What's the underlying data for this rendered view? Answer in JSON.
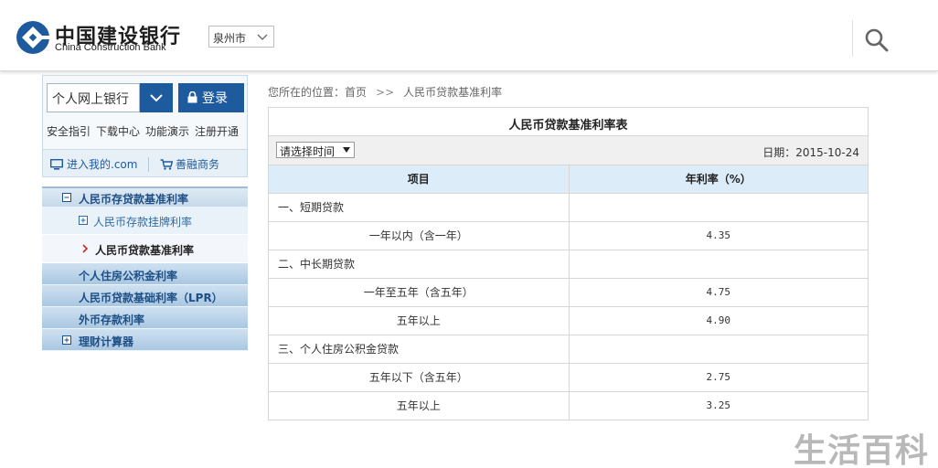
{
  "header": {
    "logo_cn": "中国建设银行",
    "logo_en": "China Construction Bank",
    "city": "泉州市"
  },
  "sidebar": {
    "bank_select": "个人网上银行",
    "login_label": "登录",
    "quick_links": [
      "安全指引",
      "下载中心",
      "功能演示",
      "注册开通"
    ],
    "enter_my": "进入我的.com",
    "shop": "善融商务",
    "menu": [
      {
        "label": "人民币存贷款基准利率",
        "kind": "top",
        "icon": "minus-box-icon"
      },
      {
        "label": "人民币存款挂牌利率",
        "kind": "sub",
        "icon": "plus-box-icon"
      },
      {
        "label": "人民币贷款基准利率",
        "kind": "sub-active",
        "icon": "chevron-right-icon"
      },
      {
        "label": "个人住房公积金利率",
        "kind": "main"
      },
      {
        "label": "人民币贷款基础利率（LPR）",
        "kind": "main"
      },
      {
        "label": "外币存款利率",
        "kind": "main"
      },
      {
        "label": "理财计算器",
        "kind": "main",
        "icon": "plus-box-icon"
      }
    ]
  },
  "breadcrumb": {
    "prefix": "您所在的位置：",
    "home": "首页",
    "sep": ">>",
    "current": "人民币贷款基准利率"
  },
  "table": {
    "title": "人民币贷款基准利率表",
    "time_select": "请选择时间",
    "date_label": "日期：2015-10-24",
    "headers": [
      "项目",
      "年利率（%）"
    ],
    "rows": [
      {
        "item": "一、短期贷款",
        "rate": "",
        "type": "cat"
      },
      {
        "item": "一年以内（含一年）",
        "rate": "4.35",
        "type": "sub"
      },
      {
        "item": "二、中长期贷款",
        "rate": "",
        "type": "cat"
      },
      {
        "item": "一年至五年（含五年）",
        "rate": "4.75",
        "type": "sub"
      },
      {
        "item": "五年以上",
        "rate": "4.90",
        "type": "sub"
      },
      {
        "item": "三、个人住房公积金贷款",
        "rate": "",
        "type": "cat"
      },
      {
        "item": "五年以下（含五年）",
        "rate": "2.75",
        "type": "sub"
      },
      {
        "item": "五年以上",
        "rate": "3.25",
        "type": "sub"
      }
    ]
  },
  "watermark": "生活百科",
  "colors": {
    "brand_blue": "#1d5a9e",
    "header_row_bg": "#dcecf9",
    "menu_text": "#1d4f86"
  }
}
